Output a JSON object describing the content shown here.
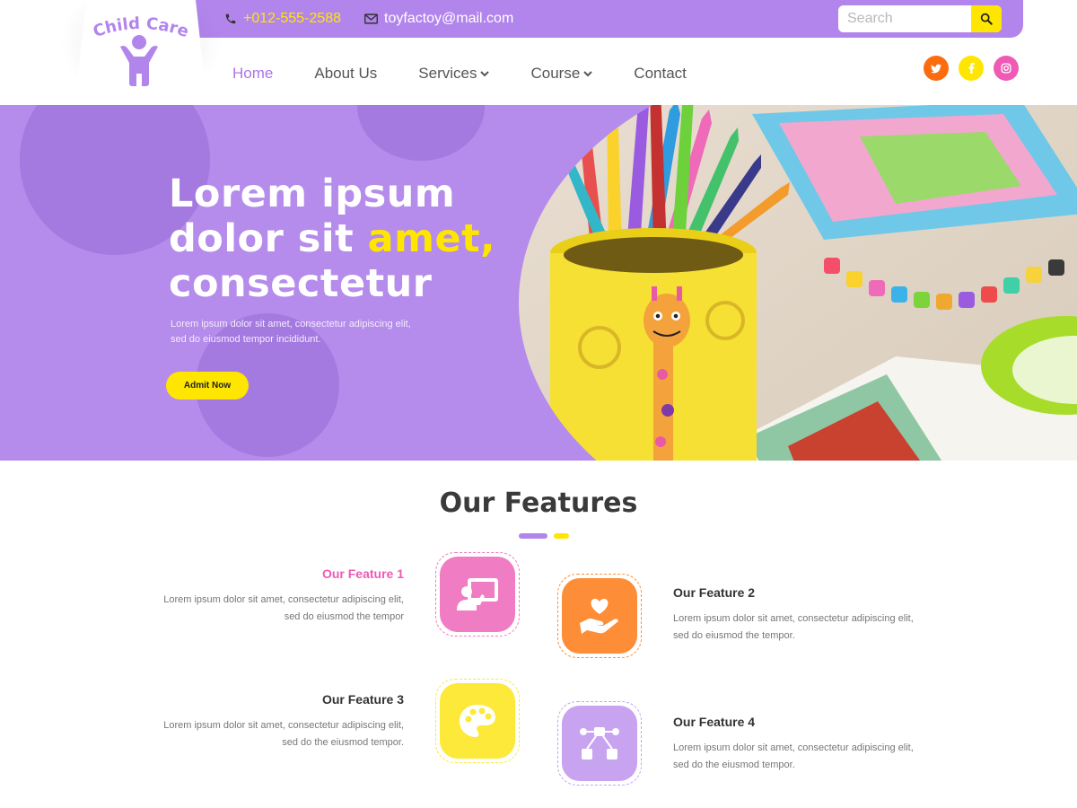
{
  "brand": {
    "name": "Child Care"
  },
  "topbar": {
    "phone": "+012-555-2588",
    "email": "toyfactoy@mail.com",
    "search_placeholder": "Search"
  },
  "nav": {
    "items": [
      {
        "label": "Home",
        "active": true
      },
      {
        "label": "About Us"
      },
      {
        "label": "Services",
        "dropdown": true
      },
      {
        "label": "Course",
        "dropdown": true
      },
      {
        "label": "Contact"
      }
    ]
  },
  "social": [
    {
      "name": "twitter",
      "color": "#fb6c0f"
    },
    {
      "name": "facebook",
      "color": "#ffe600"
    },
    {
      "name": "instagram",
      "color": "#ee5ab4"
    }
  ],
  "hero": {
    "title_line1": "Lorem ipsum",
    "title_line2_a": "dolor sit ",
    "title_line2_b": "amet,",
    "title_line3": "consectetur",
    "subtitle": "Lorem ipsum dolor sit amet, consectetur adipiscing elit, sed do eiusmod tempor incididunt.",
    "button": "Admit Now"
  },
  "features": {
    "title": "Our Features",
    "items": [
      {
        "name": "Our  Feature 1",
        "desc": "Lorem ipsum dolor sit amet, consectetur adipiscing elit, sed do eiusmod the tempor",
        "color": "#f07cc3",
        "icon": "presentation-icon"
      },
      {
        "name": "Our Feature 2",
        "desc": "Lorem ipsum dolor sit amet, consectetur adipiscing elit, sed do eiusmod the tempor.",
        "color": "#fd8d36",
        "icon": "heart-hand-icon"
      },
      {
        "name": "Our Feature 3",
        "desc": "Lorem ipsum dolor sit amet, consectetur adipiscing elit, sed do the eiusmod tempor.",
        "color": "#fce939",
        "icon": "palette-icon"
      },
      {
        "name": "Our Feature 4",
        "desc": "Lorem ipsum dolor sit amet, consectetur adipiscing elit, sed do the eiusmod tempor.",
        "color": "#c7a3f0",
        "icon": "network-icon"
      }
    ]
  },
  "colors": {
    "purple": "#b58beb",
    "yellow": "#ffe600",
    "pink": "#ee5ab4",
    "accent_text": "#b074e8"
  }
}
